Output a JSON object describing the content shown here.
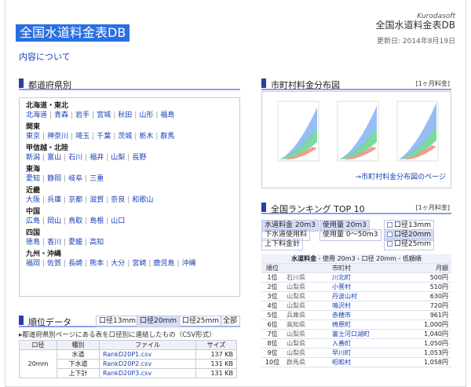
{
  "site": {
    "title": "全国水道料金表DB",
    "about_link": "内容について",
    "brand_en": "Kurodasoft",
    "brand_jp": "全国水道料金表DB",
    "updated": "更新日: 2014年8月19日"
  },
  "prefectures": {
    "heading": "都道府県別",
    "regions": [
      {
        "name": "北海道・東北",
        "items": [
          "北海道",
          "青森",
          "岩手",
          "宮城",
          "秋田",
          "山形",
          "福島"
        ]
      },
      {
        "name": "関東",
        "items": [
          "東京",
          "神奈川",
          "埼玉",
          "千葉",
          "茨城",
          "栃木",
          "群馬"
        ]
      },
      {
        "name": "甲信越・北陸",
        "items": [
          "新潟",
          "富山",
          "石川",
          "福井",
          "山梨",
          "長野"
        ]
      },
      {
        "name": "東海",
        "items": [
          "愛知",
          "静岡",
          "岐阜",
          "三重"
        ]
      },
      {
        "name": "近畿",
        "items": [
          "大阪",
          "兵庫",
          "京都",
          "滋賀",
          "奈良",
          "和歌山"
        ]
      },
      {
        "name": "中国",
        "items": [
          "広島",
          "岡山",
          "鳥取",
          "島根",
          "山口"
        ]
      },
      {
        "name": "四国",
        "items": [
          "徳島",
          "香川",
          "愛媛",
          "高知"
        ]
      },
      {
        "name": "九州・沖縄",
        "items": [
          "福岡",
          "佐賀",
          "長崎",
          "熊本",
          "大分",
          "宮崎",
          "鹿児島",
          "沖縄"
        ]
      }
    ]
  },
  "distribution": {
    "heading": "市町村料金分布図",
    "period": "[1ヶ月料金]",
    "link": "→市町村料金分布図のページ"
  },
  "ranking": {
    "heading": "全国ランキング TOP 10",
    "period": "[1ヶ月料金]",
    "tabs_type": [
      "水道料金 20m3",
      "下水道使用料",
      "上下料金計"
    ],
    "tabs_usage": [
      "使用量 20m3",
      "使用量 0〜50m3"
    ],
    "tabs_bore": [
      "口径13mm",
      "口径20mm",
      "口径25mm"
    ],
    "caption_strong": "水道料金",
    "caption_rest": " - 使用 20m3 - 口径 20mm - 低額順",
    "cols": [
      "順位",
      "市町村",
      "月額"
    ],
    "rows": [
      {
        "rank": "1位",
        "pref": "石川県",
        "city": "川北町",
        "price": "500円"
      },
      {
        "rank": "2位",
        "pref": "山梨県",
        "city": "小菅村",
        "price": "510円"
      },
      {
        "rank": "3位",
        "pref": "山梨県",
        "city": "丹波山村",
        "price": "630円"
      },
      {
        "rank": "4位",
        "pref": "山梨県",
        "city": "鳴沢村",
        "price": "720円"
      },
      {
        "rank": "5位",
        "pref": "兵庫県",
        "city": "赤穂市",
        "price": "961円"
      },
      {
        "rank": "6位",
        "pref": "高知県",
        "city": "梼原町",
        "price": "1,000円"
      },
      {
        "rank": "7位",
        "pref": "山梨県",
        "city": "富士河口湖町",
        "price": "1,040円"
      },
      {
        "rank": "8位",
        "pref": "山梨県",
        "city": "入善町",
        "price": "1,050円"
      },
      {
        "rank": "9位",
        "pref": "山梨県",
        "city": "早川町",
        "price": "1,053円"
      },
      {
        "rank": "10位",
        "pref": "群馬県",
        "city": "昭和村",
        "price": "1,058円"
      }
    ]
  },
  "downloads": {
    "heading": "順位データ",
    "tabs": [
      "口径13mm",
      "口径20mm",
      "口径25mm",
      "全部"
    ],
    "note": "▸都道府県別ページにある表を口径別に連結したもの（CSV形式）",
    "cols": [
      "口径",
      "種別",
      "ファイル",
      "サイズ"
    ],
    "bore": "20mm",
    "rows": [
      {
        "kind": "水道",
        "file": "RankD20P1.csv",
        "size": "137 KB"
      },
      {
        "kind": "下水道",
        "file": "RankD20P2.csv",
        "size": "131 KB"
      },
      {
        "kind": "上下計",
        "file": "RankD20P3.csv",
        "size": "131 KB"
      }
    ]
  },
  "colors": {
    "accent": "#2a6fe0",
    "link": "#1a3fb8",
    "rule": "#8da0e6",
    "mark": "#2b3f9e"
  }
}
